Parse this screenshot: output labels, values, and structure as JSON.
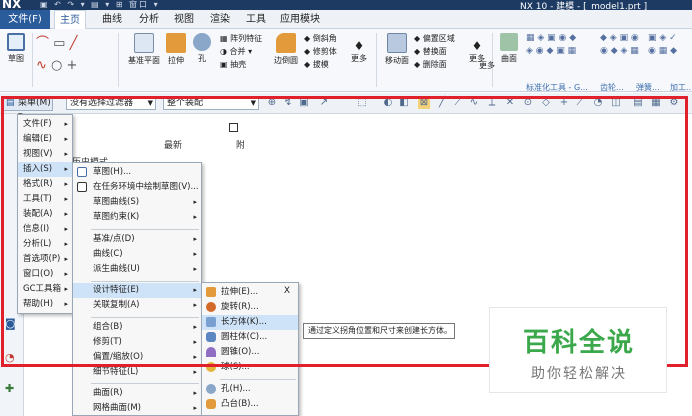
{
  "titlebar": {
    "logo": "NX",
    "title": "NX 10 - 建模 - [_model1.prt ]",
    "quick": "▣ ↶ ↷ ▾ ▤ ▾ ⊞ 窗口 ▾"
  },
  "tabs": [
    {
      "label": "文件(F)"
    },
    {
      "label": "主页"
    },
    {
      "label": "曲线"
    },
    {
      "label": "分析"
    },
    {
      "label": "视图"
    },
    {
      "label": "渲染"
    },
    {
      "label": "工具"
    },
    {
      "label": "应用模块"
    }
  ],
  "ribbon": {
    "sketch": "草图",
    "datum_plane": "基准平面",
    "extrude": "拉伸",
    "hole": "孔",
    "pattern": "阵列特征",
    "unite": "合并",
    "shell": "抽壳",
    "edge_blend": "边倒圆",
    "chamfer": "倒斜角",
    "trim_body": "修剪体",
    "draft": "拔模",
    "more1": "更多",
    "move_face": "移动面",
    "offset_region": "偏置区域",
    "replace_face": "替换面",
    "delete_face": "删除面",
    "more2": "更多",
    "surface": "曲面",
    "more3": "更多",
    "group_std": "标准化工具 - G...",
    "group_gear": "齿轮...",
    "group_spring": "弹簧...",
    "group_process": "加工..."
  },
  "cmdbar": {
    "menu": "菜单(M) ▾",
    "filter": "没有选择过滤器",
    "assembly": "整个装配"
  },
  "partnav": {
    "col_latest": "最新",
    "col_d": "附",
    "row1": "历史模式"
  },
  "main_menu": [
    {
      "label": "文件(F)"
    },
    {
      "label": "编辑(E)"
    },
    {
      "label": "视图(V)"
    },
    {
      "label": "插入(S)"
    },
    {
      "label": "格式(R)"
    },
    {
      "label": "工具(T)"
    },
    {
      "label": "装配(A)"
    },
    {
      "label": "信息(I)"
    },
    {
      "label": "分析(L)"
    },
    {
      "label": "首选项(P)"
    },
    {
      "label": "窗口(O)"
    },
    {
      "label": "GC工具箱"
    },
    {
      "label": "帮助(H)"
    }
  ],
  "insert_menu": [
    {
      "label": "草图(H)..."
    },
    {
      "label": "在任务环境中绘制草图(V)..."
    },
    {
      "label": "草图曲线(S)"
    },
    {
      "label": "草图约束(K)"
    },
    {
      "label": "基准/点(D)"
    },
    {
      "label": "曲线(C)"
    },
    {
      "label": "派生曲线(U)"
    },
    {
      "label": "设计特征(E)"
    },
    {
      "label": "关联复制(A)"
    },
    {
      "label": "组合(B)"
    },
    {
      "label": "修剪(T)"
    },
    {
      "label": "偏置/缩放(O)"
    },
    {
      "label": "细节特征(L)"
    },
    {
      "label": "曲面(R)"
    },
    {
      "label": "网格曲面(M)"
    }
  ],
  "design_menu": [
    {
      "label": "拉伸(E)..."
    },
    {
      "label": "旋转(R)..."
    },
    {
      "label": "长方体(K)..."
    },
    {
      "label": "圆柱体(C)..."
    },
    {
      "label": "圆锥(O)..."
    },
    {
      "label": "球(S)..."
    },
    {
      "label": "孔(H)..."
    },
    {
      "label": "凸台(B)..."
    }
  ],
  "design_menu_close": "X",
  "tooltip": "通过定义拐角位置和尺寸来创建长方体。",
  "watermark": {
    "title": "百科全说",
    "subtitle": "助你轻松解决"
  }
}
